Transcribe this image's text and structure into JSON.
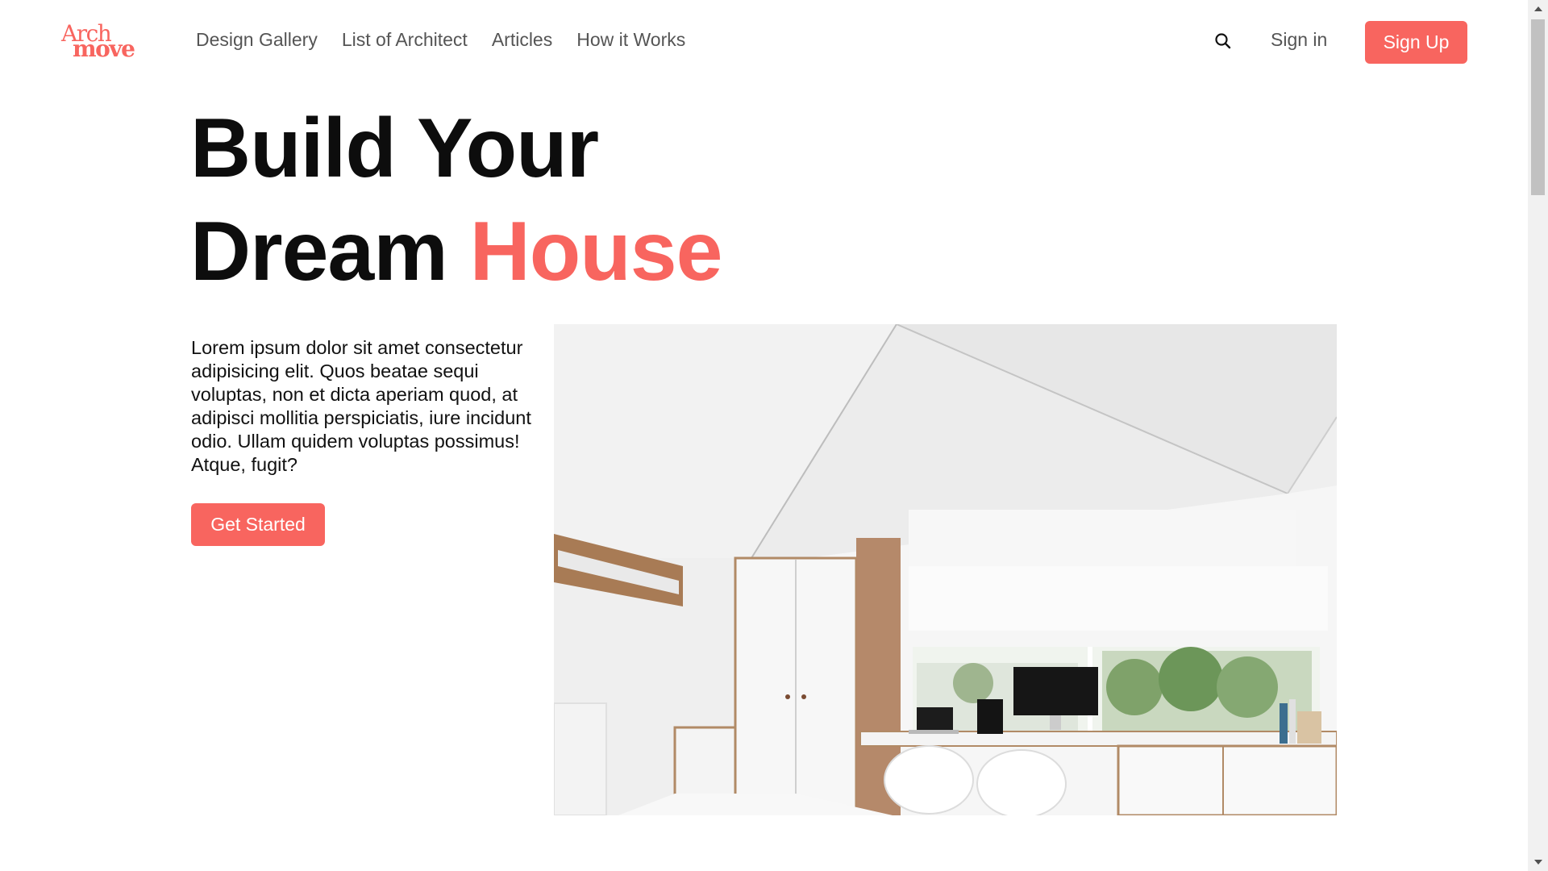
{
  "brand": {
    "logo_line1": "Arch",
    "logo_line2": "move",
    "accent_color": "#F8655F"
  },
  "nav": {
    "items": [
      {
        "label": "Design Gallery"
      },
      {
        "label": "List of Architect"
      },
      {
        "label": "Articles"
      },
      {
        "label": "How it Works"
      }
    ]
  },
  "header": {
    "search_icon": "search-icon",
    "sign_in_label": "Sign in",
    "sign_up_label": "Sign Up"
  },
  "hero": {
    "title_line1": "Build Your",
    "title_line2_plain": "Dream",
    "title_line2_accent": "House",
    "description": "Lorem ipsum dolor sit amet consectetur adipisicing elit. Quos beatae sequi voluptas, non et dicta aperiam quod, at adipisci mollitia perspiciatis, iure incidunt odio. Ullam quidem voluptas possimus! Atque, fugit?",
    "cta_label": "Get Started",
    "image": "white-minimal-bedroom-office-photo"
  },
  "scrollbar": {
    "up_icon": "arrow-up-icon",
    "down_icon": "arrow-down-icon"
  }
}
